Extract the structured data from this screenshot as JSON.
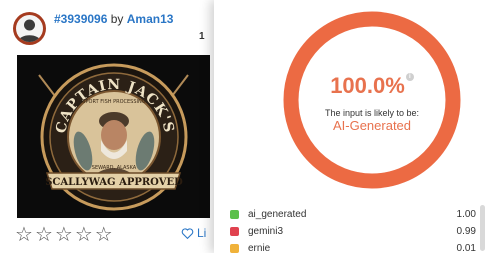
{
  "post": {
    "id": "#3939096",
    "by_text": "by",
    "author": "Aman13",
    "partial_count": "1"
  },
  "artwork": {
    "title": "CAPTAIN JACK'S",
    "tagline": "SPORT FISH PROCESSING",
    "location": "SEWARD, ALASKA",
    "banner": "SCALLYWAG APPROVED"
  },
  "rating": {
    "stars": [
      "☆",
      "☆",
      "☆",
      "☆",
      "☆"
    ],
    "filled": 0
  },
  "like": {
    "label": "Li"
  },
  "detector": {
    "score": "100.0%",
    "info_glyph": "i",
    "likely_text": "The input is likely to be:",
    "verdict": "AI-Generated",
    "ring_fraction": 1.0,
    "ring_color": "#ec6a43",
    "results": [
      {
        "label": "ai_generated",
        "value": "1.00",
        "color": "#5cc04a"
      },
      {
        "label": "gemini3",
        "value": "0.99",
        "color": "#e0424f"
      },
      {
        "label": "ernie",
        "value": "0.01",
        "color": "#f0b23a"
      }
    ]
  }
}
